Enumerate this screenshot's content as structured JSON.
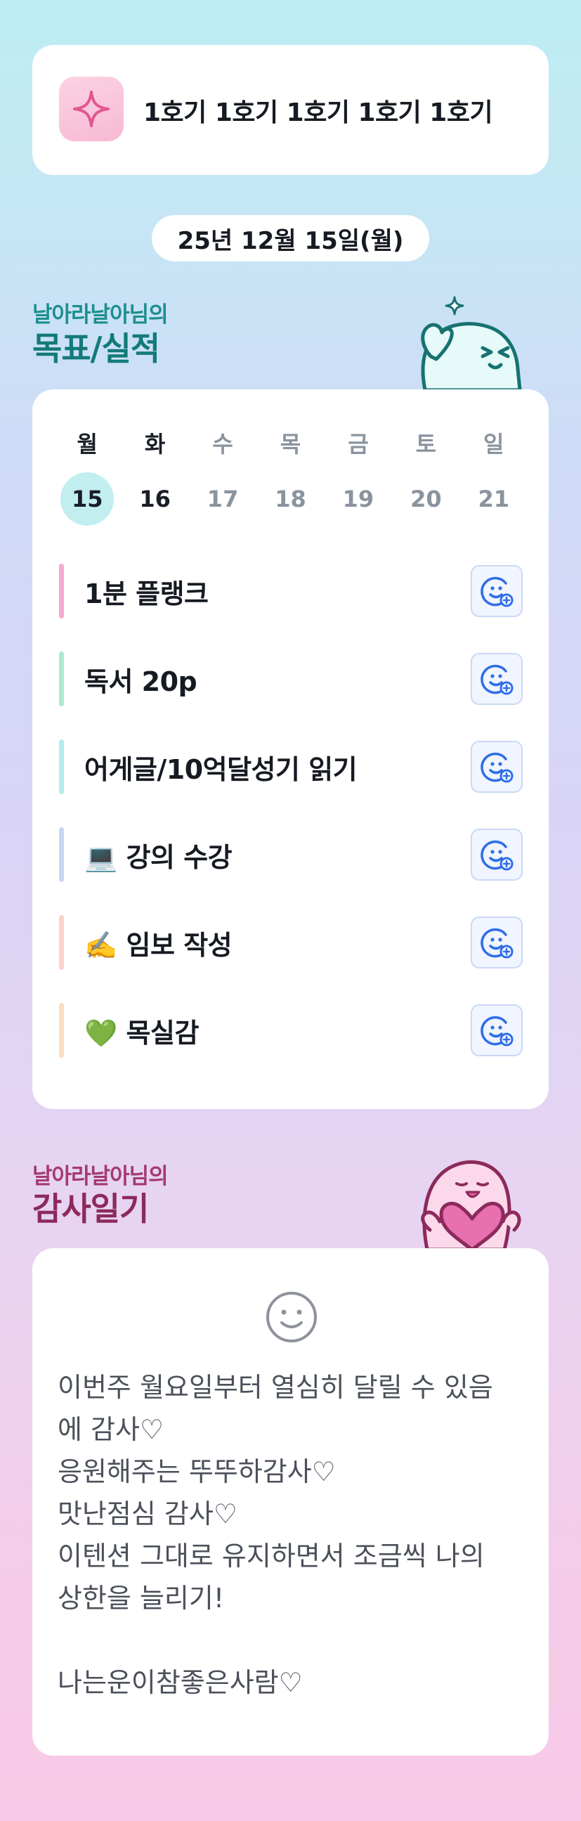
{
  "header": {
    "icon": "sparkle-icon",
    "title": "1호기 1호기 1호기 1호기 1호기"
  },
  "date": "25년 12월 15일(월)",
  "goals_section": {
    "subtitle": "날아라날아님의",
    "title": "목표/실적"
  },
  "week": {
    "days": [
      {
        "label": "월",
        "date": "15",
        "selected": true
      },
      {
        "label": "화",
        "date": "16",
        "selected": false
      },
      {
        "label": "수",
        "date": "17",
        "selected": false
      },
      {
        "label": "목",
        "date": "18",
        "selected": false
      },
      {
        "label": "금",
        "date": "19",
        "selected": false
      },
      {
        "label": "토",
        "date": "20",
        "selected": false
      },
      {
        "label": "일",
        "date": "21",
        "selected": false
      }
    ]
  },
  "goals": [
    {
      "label": "1분 플랭크",
      "color": "#f6a9d2"
    },
    {
      "label": "독서 20p",
      "color": "#aee9cf"
    },
    {
      "label": "어게글/10억달성기 읽기",
      "color": "#b7ecec"
    },
    {
      "label": "💻 강의 수강",
      "color": "#c9d7f6"
    },
    {
      "label": "✍️ 임보 작성",
      "color": "#fbd1cc"
    },
    {
      "label": "💚 목실감",
      "color": "#fbdcc0"
    }
  ],
  "goal_button_icon": "smile-plus-icon",
  "diary_section": {
    "subtitle": "날아라날아님의",
    "title": "감사일기"
  },
  "diary": {
    "icon": "smile-icon",
    "lines": [
      "이번주 월요일부터 열심히 달릴 수 있음",
      "에 감사♡",
      "응원해주는 뚜뚜하감사♡",
      "맛난점심 감사♡",
      "이텐션 그대로 유지하면서 조금씩 나의",
      "상한을 늘리기!",
      "",
      "나는운이참좋은사람♡"
    ]
  }
}
